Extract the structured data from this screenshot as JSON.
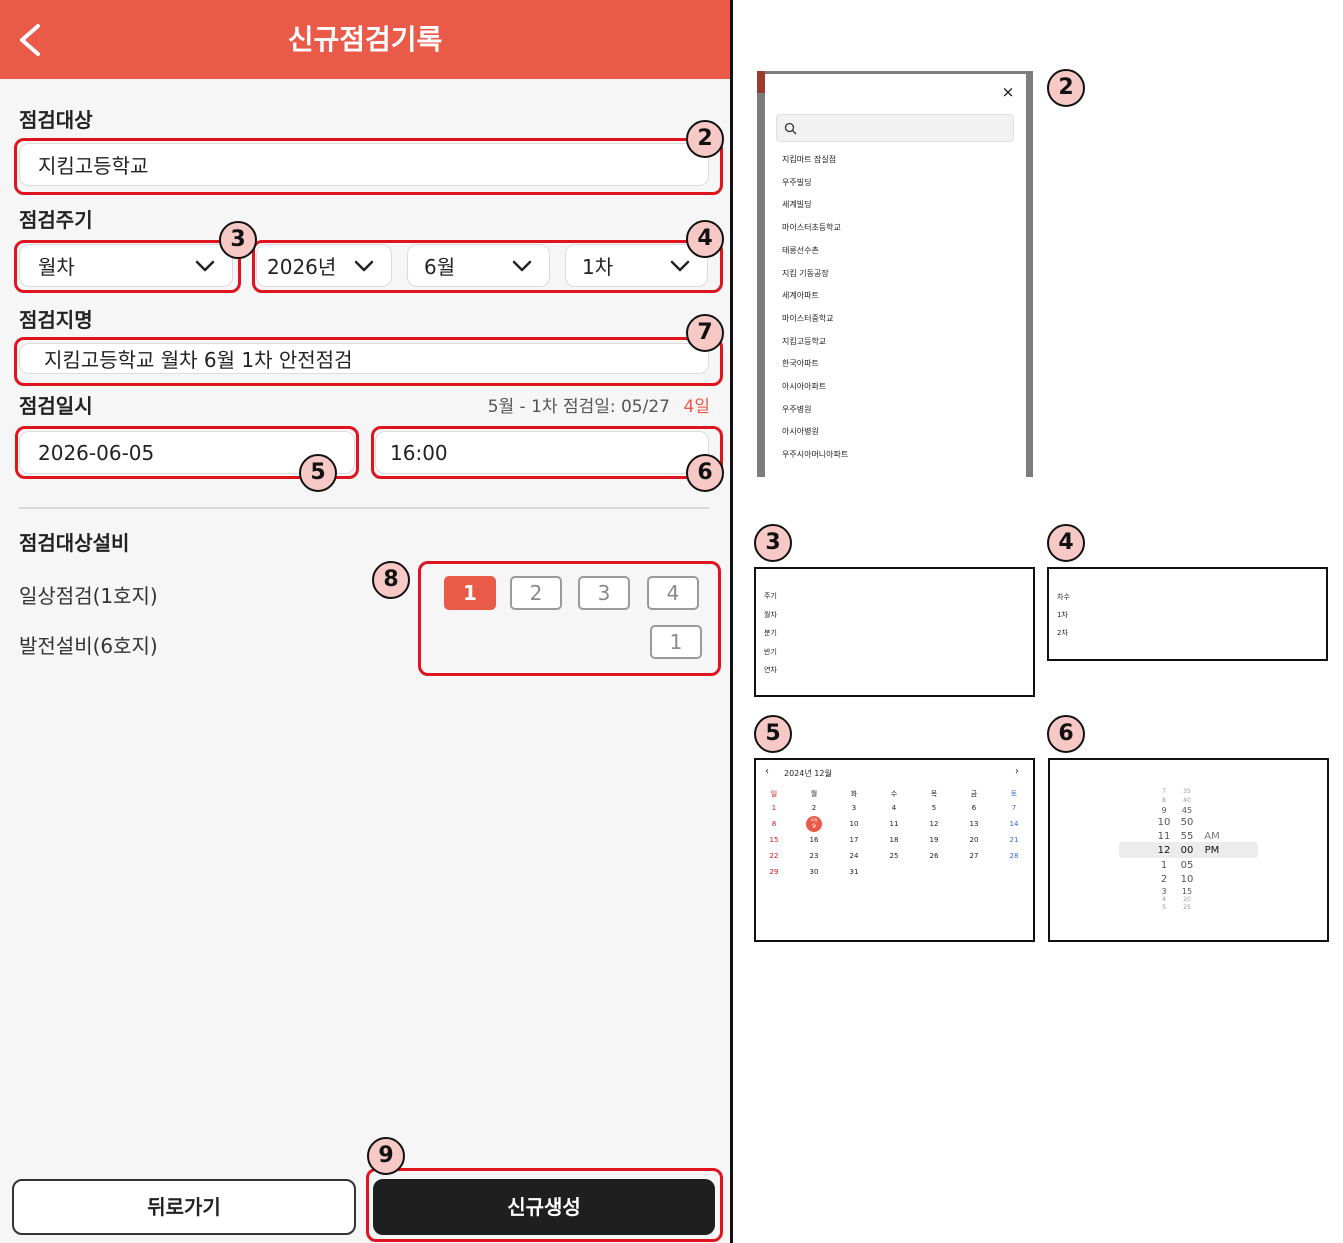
{
  "header": {
    "title": "신규점검기록"
  },
  "target": {
    "label": "점검대상",
    "value": "지킴고등학교"
  },
  "cycle": {
    "label": "점검주기",
    "period": "월차",
    "year": "2026년",
    "month": "6월",
    "round": "1차"
  },
  "inspection_name": {
    "label": "점검지명",
    "value": "지킴고등학교 월차 6월 1차 안전점검"
  },
  "datetime": {
    "label": "점검일시",
    "prev_info": "5월 - 1차 점검일: 05/27",
    "days_ago": "4일",
    "date": "2026-06-05",
    "time": "16:00"
  },
  "equipment": {
    "label": "점검대상설비",
    "rows": [
      {
        "name": "일상점검(1호지)",
        "chips": [
          "1",
          "2",
          "3",
          "4"
        ],
        "selected": 0
      },
      {
        "name": "발전설비(6호지)",
        "chips": [
          "1"
        ],
        "selected": -1
      }
    ]
  },
  "footer": {
    "back": "뒤로가기",
    "create": "신규생성"
  },
  "badges": {
    "b2": "2",
    "b3": "3",
    "b4": "4",
    "b5": "5",
    "b6": "6",
    "b7": "7",
    "b8": "8",
    "b9": "9"
  },
  "popup_target": {
    "close": "×",
    "items": [
      "지킴마트 잠실점",
      "우주빌딩",
      "세계빌딩",
      "마이스터초등학교",
      "태릉선수촌",
      "지킴 기동공장",
      "세계아파트",
      "마이스터중학교",
      "지킴고등학교",
      "한국아파트",
      "아시아아파트",
      "우주병원",
      "아시아병원",
      "우주시아머니아파트"
    ]
  },
  "popup_cycle": {
    "items": [
      "주기",
      "월차",
      "분기",
      "반기",
      "연차"
    ]
  },
  "popup_round": {
    "items": [
      "차수",
      "1차",
      "2차"
    ]
  },
  "popup_calendar": {
    "title": "2024년 12월",
    "prev": "‹",
    "next": "›",
    "weekdays": [
      "일",
      "월",
      "화",
      "수",
      "목",
      "금",
      "토"
    ],
    "weeks": [
      [
        "1",
        "2",
        "3",
        "4",
        "5",
        "6",
        "7"
      ],
      [
        "8",
        "9",
        "10",
        "11",
        "12",
        "13",
        "14"
      ],
      [
        "15",
        "16",
        "17",
        "18",
        "19",
        "20",
        "21"
      ],
      [
        "22",
        "23",
        "24",
        "25",
        "26",
        "27",
        "28"
      ],
      [
        "29",
        "30",
        "31",
        "",
        "",
        "",
        ""
      ]
    ],
    "today_label": "오늘",
    "today_day": "9",
    "sunday_color": "#e0141e",
    "saturday_color": "#2a6fd6"
  },
  "popup_time": {
    "hours": [
      "7",
      "8",
      "9",
      "10",
      "11",
      "12",
      "1",
      "2",
      "3",
      "4",
      "5"
    ],
    "minutes": [
      "35",
      "40",
      "45",
      "50",
      "55",
      "00",
      "05",
      "10",
      "15",
      "20",
      "25"
    ],
    "ampm": [
      "AM",
      "PM"
    ],
    "selected_index": 5
  },
  "colors": {
    "accent": "#e95a48",
    "highlight": "#e0141e",
    "badge_fill": "#f7c9c6",
    "dark_button": "#1f1f1f"
  }
}
